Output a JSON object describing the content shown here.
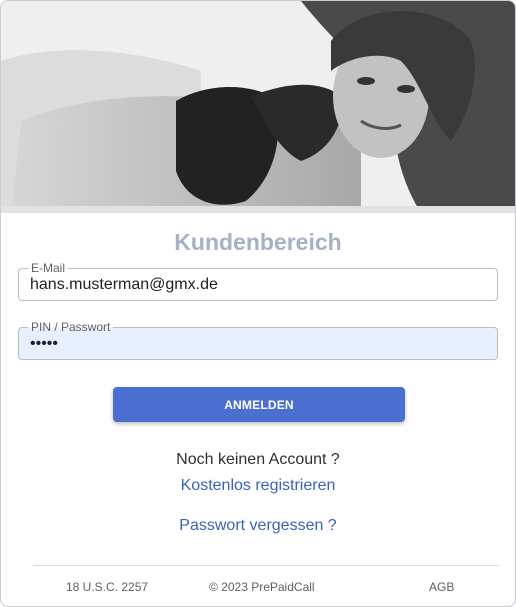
{
  "header": {
    "title": "Kundenbereich"
  },
  "form": {
    "email": {
      "label": "E-Mail",
      "value": "hans.musterman@gmx.de"
    },
    "pin": {
      "label": "PIN / Passwort",
      "value": "•••••"
    },
    "submit_label": "ANMELDEN"
  },
  "signup": {
    "prompt": "Noch keinen Account ?",
    "register_link": "Kostenlos registrieren",
    "forgot_link": "Passwort vergessen ?"
  },
  "footer": {
    "usc": "18 U.S.C. 2257",
    "copyright": "© 2023 PrePaidCall",
    "agb": "AGB"
  },
  "colors": {
    "accent": "#4a6fd0",
    "link": "#3c62b8",
    "title": "#a7b0c5",
    "autofill_bg": "#e8f0fe"
  }
}
